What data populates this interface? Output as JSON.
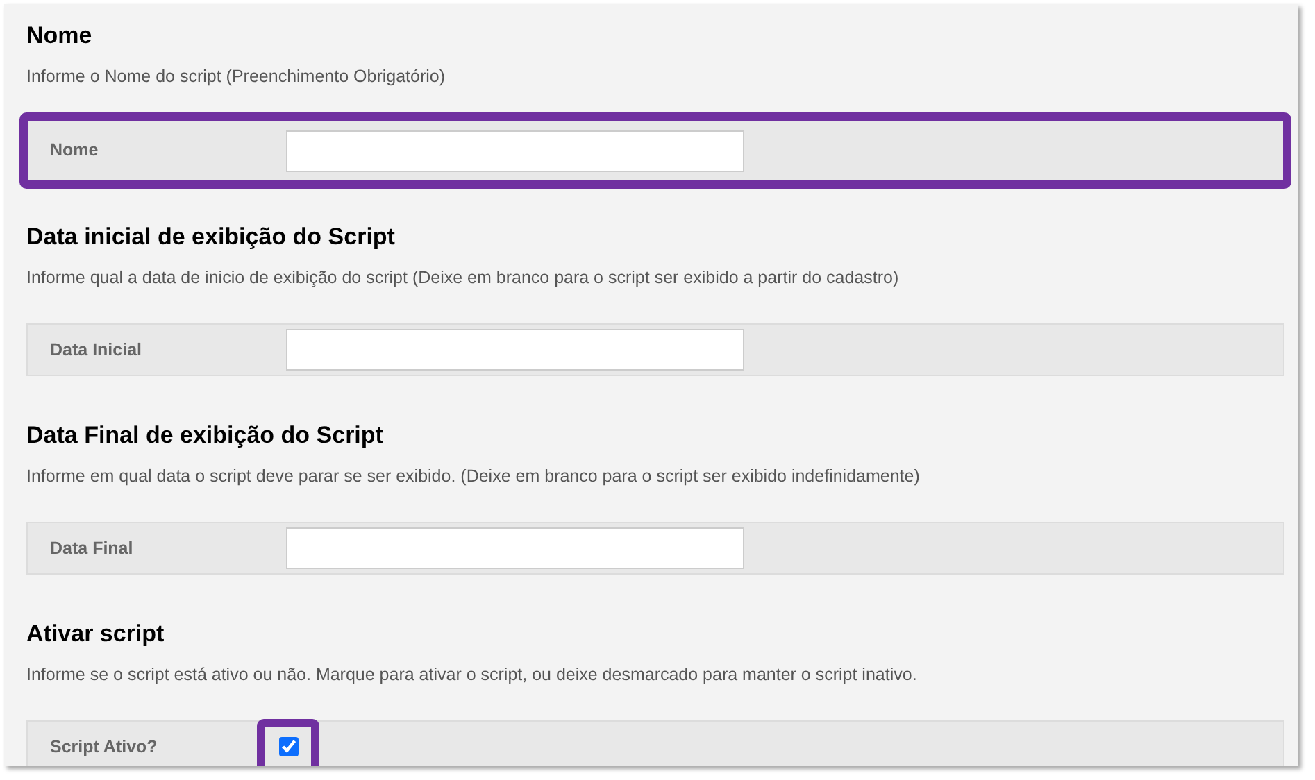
{
  "sections": [
    {
      "title": "Nome",
      "hint": "Informe o Nome do script (Preenchimento Obrigatório)",
      "field": {
        "kind": "text",
        "label": "Nome",
        "highlighted": true
      }
    },
    {
      "title": "Data inicial de exibição do Script",
      "hint": "Informe qual a data de inicio de exibição do script (Deixe em branco para o script ser exibido a partir do cadastro)",
      "field": {
        "kind": "text",
        "label": "Data Inicial",
        "highlighted": false
      }
    },
    {
      "title": "Data Final de exibição do Script",
      "hint": "Informe em qual data o script deve parar se ser exibido. (Deixe em branco para o script ser exibido indefinidamente)",
      "field": {
        "kind": "text",
        "label": "Data Final",
        "highlighted": false
      }
    },
    {
      "title": "Ativar script",
      "hint": "Informe se o script está ativo ou não. Marque para ativar o script, ou deixe desmarcado para manter o script inativo.",
      "field": {
        "kind": "checkbox",
        "label": "Script Ativo?",
        "checked": true,
        "highlighted": true
      }
    }
  ]
}
